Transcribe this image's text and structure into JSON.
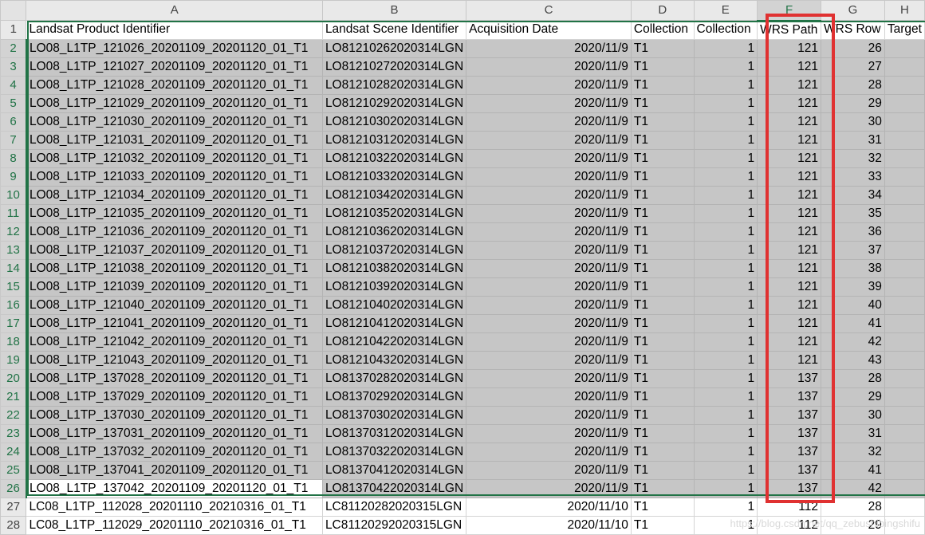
{
  "columns": [
    "A",
    "B",
    "C",
    "D",
    "E",
    "F",
    "G",
    "H"
  ],
  "headers": [
    "Landsat Product Identifier",
    "Landsat Scene Identifier",
    "Acquisition Date",
    "Collection",
    "Collection",
    "WRS Path",
    "WRS Row",
    "Target"
  ],
  "rows": [
    {
      "num": "2",
      "product_id": "LO08_L1TP_121026_20201109_20201120_01_T1",
      "scene_id": "LO81210262020314LGN",
      "date": "2020/11/9",
      "collection_cat": "T1",
      "collection_num": "1",
      "path": "121",
      "row": "26"
    },
    {
      "num": "3",
      "product_id": "LO08_L1TP_121027_20201109_20201120_01_T1",
      "scene_id": "LO81210272020314LGN",
      "date": "2020/11/9",
      "collection_cat": "T1",
      "collection_num": "1",
      "path": "121",
      "row": "27"
    },
    {
      "num": "4",
      "product_id": "LO08_L1TP_121028_20201109_20201120_01_T1",
      "scene_id": "LO81210282020314LGN",
      "date": "2020/11/9",
      "collection_cat": "T1",
      "collection_num": "1",
      "path": "121",
      "row": "28"
    },
    {
      "num": "5",
      "product_id": "LO08_L1TP_121029_20201109_20201120_01_T1",
      "scene_id": "LO81210292020314LGN",
      "date": "2020/11/9",
      "collection_cat": "T1",
      "collection_num": "1",
      "path": "121",
      "row": "29"
    },
    {
      "num": "6",
      "product_id": "LO08_L1TP_121030_20201109_20201120_01_T1",
      "scene_id": "LO81210302020314LGN",
      "date": "2020/11/9",
      "collection_cat": "T1",
      "collection_num": "1",
      "path": "121",
      "row": "30"
    },
    {
      "num": "7",
      "product_id": "LO08_L1TP_121031_20201109_20201120_01_T1",
      "scene_id": "LO81210312020314LGN",
      "date": "2020/11/9",
      "collection_cat": "T1",
      "collection_num": "1",
      "path": "121",
      "row": "31"
    },
    {
      "num": "8",
      "product_id": "LO08_L1TP_121032_20201109_20201120_01_T1",
      "scene_id": "LO81210322020314LGN",
      "date": "2020/11/9",
      "collection_cat": "T1",
      "collection_num": "1",
      "path": "121",
      "row": "32"
    },
    {
      "num": "9",
      "product_id": "LO08_L1TP_121033_20201109_20201120_01_T1",
      "scene_id": "LO81210332020314LGN",
      "date": "2020/11/9",
      "collection_cat": "T1",
      "collection_num": "1",
      "path": "121",
      "row": "33"
    },
    {
      "num": "10",
      "product_id": "LO08_L1TP_121034_20201109_20201120_01_T1",
      "scene_id": "LO81210342020314LGN",
      "date": "2020/11/9",
      "collection_cat": "T1",
      "collection_num": "1",
      "path": "121",
      "row": "34"
    },
    {
      "num": "11",
      "product_id": "LO08_L1TP_121035_20201109_20201120_01_T1",
      "scene_id": "LO81210352020314LGN",
      "date": "2020/11/9",
      "collection_cat": "T1",
      "collection_num": "1",
      "path": "121",
      "row": "35"
    },
    {
      "num": "12",
      "product_id": "LO08_L1TP_121036_20201109_20201120_01_T1",
      "scene_id": "LO81210362020314LGN",
      "date": "2020/11/9",
      "collection_cat": "T1",
      "collection_num": "1",
      "path": "121",
      "row": "36"
    },
    {
      "num": "13",
      "product_id": "LO08_L1TP_121037_20201109_20201120_01_T1",
      "scene_id": "LO81210372020314LGN",
      "date": "2020/11/9",
      "collection_cat": "T1",
      "collection_num": "1",
      "path": "121",
      "row": "37"
    },
    {
      "num": "14",
      "product_id": "LO08_L1TP_121038_20201109_20201120_01_T1",
      "scene_id": "LO81210382020314LGN",
      "date": "2020/11/9",
      "collection_cat": "T1",
      "collection_num": "1",
      "path": "121",
      "row": "38"
    },
    {
      "num": "15",
      "product_id": "LO08_L1TP_121039_20201109_20201120_01_T1",
      "scene_id": "LO81210392020314LGN",
      "date": "2020/11/9",
      "collection_cat": "T1",
      "collection_num": "1",
      "path": "121",
      "row": "39"
    },
    {
      "num": "16",
      "product_id": "LO08_L1TP_121040_20201109_20201120_01_T1",
      "scene_id": "LO81210402020314LGN",
      "date": "2020/11/9",
      "collection_cat": "T1",
      "collection_num": "1",
      "path": "121",
      "row": "40"
    },
    {
      "num": "17",
      "product_id": "LO08_L1TP_121041_20201109_20201120_01_T1",
      "scene_id": "LO81210412020314LGN",
      "date": "2020/11/9",
      "collection_cat": "T1",
      "collection_num": "1",
      "path": "121",
      "row": "41"
    },
    {
      "num": "18",
      "product_id": "LO08_L1TP_121042_20201109_20201120_01_T1",
      "scene_id": "LO81210422020314LGN",
      "date": "2020/11/9",
      "collection_cat": "T1",
      "collection_num": "1",
      "path": "121",
      "row": "42"
    },
    {
      "num": "19",
      "product_id": "LO08_L1TP_121043_20201109_20201120_01_T1",
      "scene_id": "LO81210432020314LGN",
      "date": "2020/11/9",
      "collection_cat": "T1",
      "collection_num": "1",
      "path": "121",
      "row": "43"
    },
    {
      "num": "20",
      "product_id": "LO08_L1TP_137028_20201109_20201120_01_T1",
      "scene_id": "LO81370282020314LGN",
      "date": "2020/11/9",
      "collection_cat": "T1",
      "collection_num": "1",
      "path": "137",
      "row": "28"
    },
    {
      "num": "21",
      "product_id": "LO08_L1TP_137029_20201109_20201120_01_T1",
      "scene_id": "LO81370292020314LGN",
      "date": "2020/11/9",
      "collection_cat": "T1",
      "collection_num": "1",
      "path": "137",
      "row": "29"
    },
    {
      "num": "22",
      "product_id": "LO08_L1TP_137030_20201109_20201120_01_T1",
      "scene_id": "LO81370302020314LGN",
      "date": "2020/11/9",
      "collection_cat": "T1",
      "collection_num": "1",
      "path": "137",
      "row": "30"
    },
    {
      "num": "23",
      "product_id": "LO08_L1TP_137031_20201109_20201120_01_T1",
      "scene_id": "LO81370312020314LGN",
      "date": "2020/11/9",
      "collection_cat": "T1",
      "collection_num": "1",
      "path": "137",
      "row": "31"
    },
    {
      "num": "24",
      "product_id": "LO08_L1TP_137032_20201109_20201120_01_T1",
      "scene_id": "LO81370322020314LGN",
      "date": "2020/11/9",
      "collection_cat": "T1",
      "collection_num": "1",
      "path": "137",
      "row": "32"
    },
    {
      "num": "25",
      "product_id": "LO08_L1TP_137041_20201109_20201120_01_T1",
      "scene_id": "LO81370412020314LGN",
      "date": "2020/11/9",
      "collection_cat": "T1",
      "collection_num": "1",
      "path": "137",
      "row": "41"
    },
    {
      "num": "26",
      "product_id": "LO08_L1TP_137042_20201109_20201120_01_T1",
      "scene_id": "LO81370422020314LGN",
      "date": "2020/11/9",
      "collection_cat": "T1",
      "collection_num": "1",
      "path": "137",
      "row": "42"
    },
    {
      "num": "27",
      "product_id": "LC08_L1TP_112028_20201110_20210316_01_T1",
      "scene_id": "LC81120282020315LGN",
      "date": "2020/11/10",
      "collection_cat": "T1",
      "collection_num": "1",
      "path": "112",
      "row": "28"
    },
    {
      "num": "28",
      "product_id": "LC08_L1TP_112029_20201110_20210316_01_T1",
      "scene_id": "LC81120292020315LGN",
      "date": "2020/11/10",
      "collection_cat": "T1",
      "collection_num": "1",
      "path": "112",
      "row": "29"
    }
  ],
  "selection": {
    "first_row": "2",
    "last_row": "26",
    "active_cell": "A26",
    "highlighted_column": "F"
  },
  "watermark": "https://blog.csdn.net/qq_zebushibingshifu",
  "colors": {
    "selection_border": "#217346",
    "highlight_box": "#e03131",
    "selected_fill": "#c6c6c6"
  }
}
